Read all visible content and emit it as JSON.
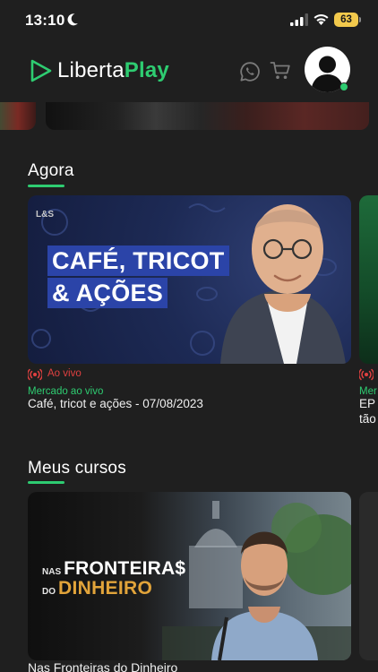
{
  "status_bar": {
    "time": "13:10",
    "battery": "63"
  },
  "header": {
    "logo_part1": "Liberta",
    "logo_part2": "Play",
    "brand_color": "#2ecc71"
  },
  "sections": {
    "agora": {
      "title": "Agora",
      "card": {
        "brand_mark": "L&S",
        "headline_line1": "CAFÉ, TRICOT",
        "headline_line2": "& AÇÕES",
        "live_label": "Ao vivo",
        "category": "Mercado ao vivo",
        "title": "Café, tricot e ações - 07/08/2023"
      },
      "next_card": {
        "category": "Mer",
        "title_line1": "EP",
        "title_line2": "tão"
      }
    },
    "meus_cursos": {
      "title": "Meus cursos",
      "card": {
        "overlay_nas": "NAS",
        "overlay_fronteiras": "FRONTEIRA$",
        "overlay_do": "DO",
        "overlay_dinheiro": "DINHEIRO",
        "title": "Nas Fronteiras do Dinheiro"
      }
    }
  },
  "icons": {
    "moon": "moon-icon",
    "signal": "cellular-signal-icon",
    "wifi": "wifi-icon",
    "logo": "play-logo-icon",
    "whatsapp": "whatsapp-icon",
    "cart": "cart-icon",
    "live": "live-broadcast-icon"
  },
  "colors": {
    "background": "#1f1f1f",
    "accent": "#2ecc71",
    "live": "#e04040",
    "headline_band": "#2b44a8",
    "gold": "#e2a43a"
  }
}
